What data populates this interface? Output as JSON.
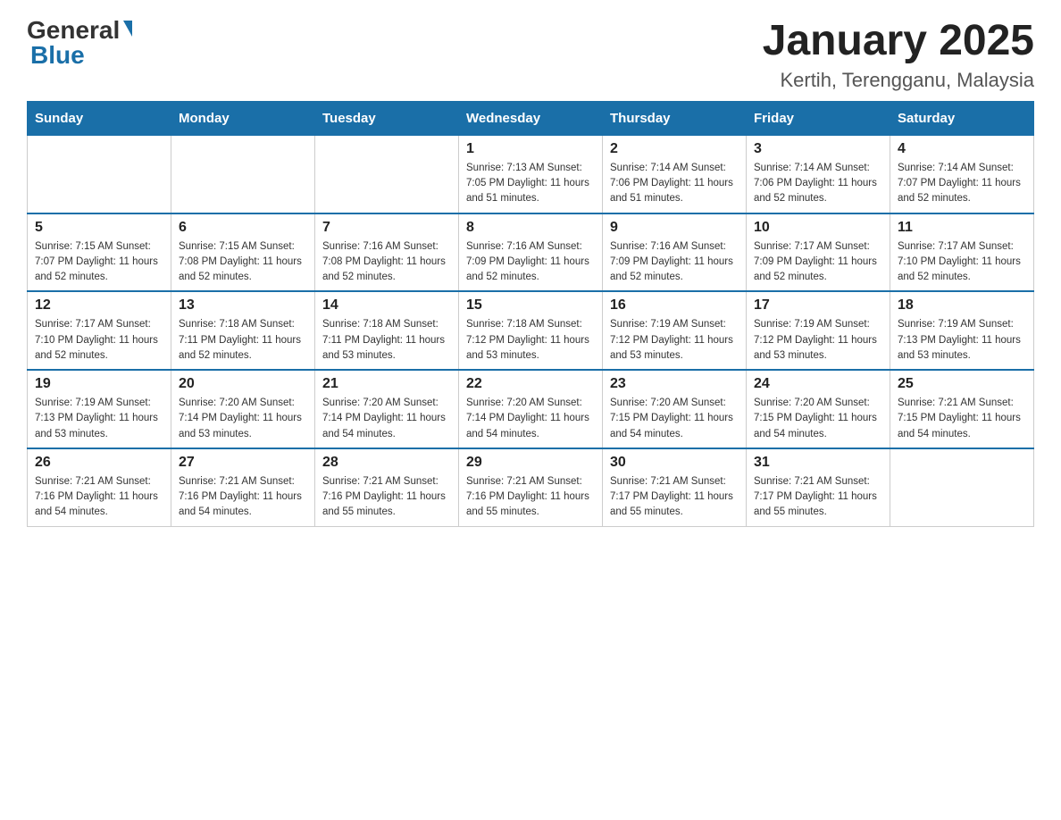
{
  "header": {
    "logo_text_general": "General",
    "logo_text_blue": "Blue",
    "month_title": "January 2025",
    "location": "Kertih, Terengganu, Malaysia"
  },
  "weekdays": [
    "Sunday",
    "Monday",
    "Tuesday",
    "Wednesday",
    "Thursday",
    "Friday",
    "Saturday"
  ],
  "weeks": [
    [
      {
        "day": "",
        "info": ""
      },
      {
        "day": "",
        "info": ""
      },
      {
        "day": "",
        "info": ""
      },
      {
        "day": "1",
        "info": "Sunrise: 7:13 AM\nSunset: 7:05 PM\nDaylight: 11 hours\nand 51 minutes."
      },
      {
        "day": "2",
        "info": "Sunrise: 7:14 AM\nSunset: 7:06 PM\nDaylight: 11 hours\nand 51 minutes."
      },
      {
        "day": "3",
        "info": "Sunrise: 7:14 AM\nSunset: 7:06 PM\nDaylight: 11 hours\nand 52 minutes."
      },
      {
        "day": "4",
        "info": "Sunrise: 7:14 AM\nSunset: 7:07 PM\nDaylight: 11 hours\nand 52 minutes."
      }
    ],
    [
      {
        "day": "5",
        "info": "Sunrise: 7:15 AM\nSunset: 7:07 PM\nDaylight: 11 hours\nand 52 minutes."
      },
      {
        "day": "6",
        "info": "Sunrise: 7:15 AM\nSunset: 7:08 PM\nDaylight: 11 hours\nand 52 minutes."
      },
      {
        "day": "7",
        "info": "Sunrise: 7:16 AM\nSunset: 7:08 PM\nDaylight: 11 hours\nand 52 minutes."
      },
      {
        "day": "8",
        "info": "Sunrise: 7:16 AM\nSunset: 7:09 PM\nDaylight: 11 hours\nand 52 minutes."
      },
      {
        "day": "9",
        "info": "Sunrise: 7:16 AM\nSunset: 7:09 PM\nDaylight: 11 hours\nand 52 minutes."
      },
      {
        "day": "10",
        "info": "Sunrise: 7:17 AM\nSunset: 7:09 PM\nDaylight: 11 hours\nand 52 minutes."
      },
      {
        "day": "11",
        "info": "Sunrise: 7:17 AM\nSunset: 7:10 PM\nDaylight: 11 hours\nand 52 minutes."
      }
    ],
    [
      {
        "day": "12",
        "info": "Sunrise: 7:17 AM\nSunset: 7:10 PM\nDaylight: 11 hours\nand 52 minutes."
      },
      {
        "day": "13",
        "info": "Sunrise: 7:18 AM\nSunset: 7:11 PM\nDaylight: 11 hours\nand 52 minutes."
      },
      {
        "day": "14",
        "info": "Sunrise: 7:18 AM\nSunset: 7:11 PM\nDaylight: 11 hours\nand 53 minutes."
      },
      {
        "day": "15",
        "info": "Sunrise: 7:18 AM\nSunset: 7:12 PM\nDaylight: 11 hours\nand 53 minutes."
      },
      {
        "day": "16",
        "info": "Sunrise: 7:19 AM\nSunset: 7:12 PM\nDaylight: 11 hours\nand 53 minutes."
      },
      {
        "day": "17",
        "info": "Sunrise: 7:19 AM\nSunset: 7:12 PM\nDaylight: 11 hours\nand 53 minutes."
      },
      {
        "day": "18",
        "info": "Sunrise: 7:19 AM\nSunset: 7:13 PM\nDaylight: 11 hours\nand 53 minutes."
      }
    ],
    [
      {
        "day": "19",
        "info": "Sunrise: 7:19 AM\nSunset: 7:13 PM\nDaylight: 11 hours\nand 53 minutes."
      },
      {
        "day": "20",
        "info": "Sunrise: 7:20 AM\nSunset: 7:14 PM\nDaylight: 11 hours\nand 53 minutes."
      },
      {
        "day": "21",
        "info": "Sunrise: 7:20 AM\nSunset: 7:14 PM\nDaylight: 11 hours\nand 54 minutes."
      },
      {
        "day": "22",
        "info": "Sunrise: 7:20 AM\nSunset: 7:14 PM\nDaylight: 11 hours\nand 54 minutes."
      },
      {
        "day": "23",
        "info": "Sunrise: 7:20 AM\nSunset: 7:15 PM\nDaylight: 11 hours\nand 54 minutes."
      },
      {
        "day": "24",
        "info": "Sunrise: 7:20 AM\nSunset: 7:15 PM\nDaylight: 11 hours\nand 54 minutes."
      },
      {
        "day": "25",
        "info": "Sunrise: 7:21 AM\nSunset: 7:15 PM\nDaylight: 11 hours\nand 54 minutes."
      }
    ],
    [
      {
        "day": "26",
        "info": "Sunrise: 7:21 AM\nSunset: 7:16 PM\nDaylight: 11 hours\nand 54 minutes."
      },
      {
        "day": "27",
        "info": "Sunrise: 7:21 AM\nSunset: 7:16 PM\nDaylight: 11 hours\nand 54 minutes."
      },
      {
        "day": "28",
        "info": "Sunrise: 7:21 AM\nSunset: 7:16 PM\nDaylight: 11 hours\nand 55 minutes."
      },
      {
        "day": "29",
        "info": "Sunrise: 7:21 AM\nSunset: 7:16 PM\nDaylight: 11 hours\nand 55 minutes."
      },
      {
        "day": "30",
        "info": "Sunrise: 7:21 AM\nSunset: 7:17 PM\nDaylight: 11 hours\nand 55 minutes."
      },
      {
        "day": "31",
        "info": "Sunrise: 7:21 AM\nSunset: 7:17 PM\nDaylight: 11 hours\nand 55 minutes."
      },
      {
        "day": "",
        "info": ""
      }
    ]
  ]
}
